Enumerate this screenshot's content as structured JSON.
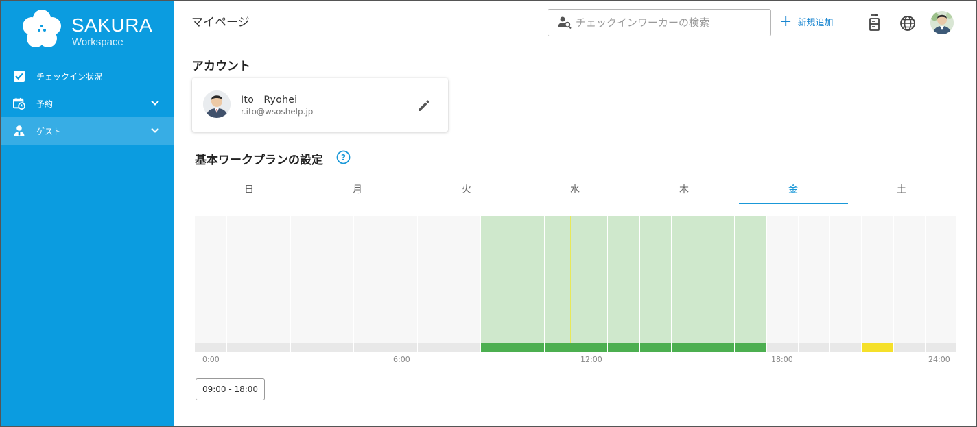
{
  "brand": {
    "name": "SAKURA",
    "subtitle": "Workspace"
  },
  "sidebar": {
    "items": [
      {
        "label": "チェックイン状況",
        "icon": "checkbox-icon",
        "active": false,
        "has_chevron": false
      },
      {
        "label": "予約",
        "icon": "calendar-clock-icon",
        "active": false,
        "has_chevron": true
      },
      {
        "label": "ゲスト",
        "icon": "guest-icon",
        "active": true,
        "has_chevron": true
      }
    ]
  },
  "header": {
    "title": "マイページ",
    "search_placeholder": "チェックインワーカーの検索",
    "add_label": "新規追加"
  },
  "account": {
    "section_title": "アカウント",
    "name": "Ito　Ryohei",
    "email": "r.ito@wsoshelp.jp"
  },
  "work_plan": {
    "section_title": "基本ワークプランの設定",
    "tabs": [
      "日",
      "月",
      "火",
      "水",
      "木",
      "金",
      "土"
    ],
    "selected_tab": "金",
    "ticks": [
      "0:00",
      "6:00",
      "12:00",
      "18:00",
      "24:00"
    ],
    "range_label": "09:00 - 18:00",
    "work_start_hour": 9,
    "work_end_hour": 18,
    "marker_start_hour": 21,
    "marker_end_hour": 22
  },
  "colors": {
    "sidebar": "#0b9ce0",
    "accent": "#1a86d0",
    "work_fill": "#cfe8cc",
    "work_bar": "#4caf50",
    "marker": "#f5e02a"
  }
}
